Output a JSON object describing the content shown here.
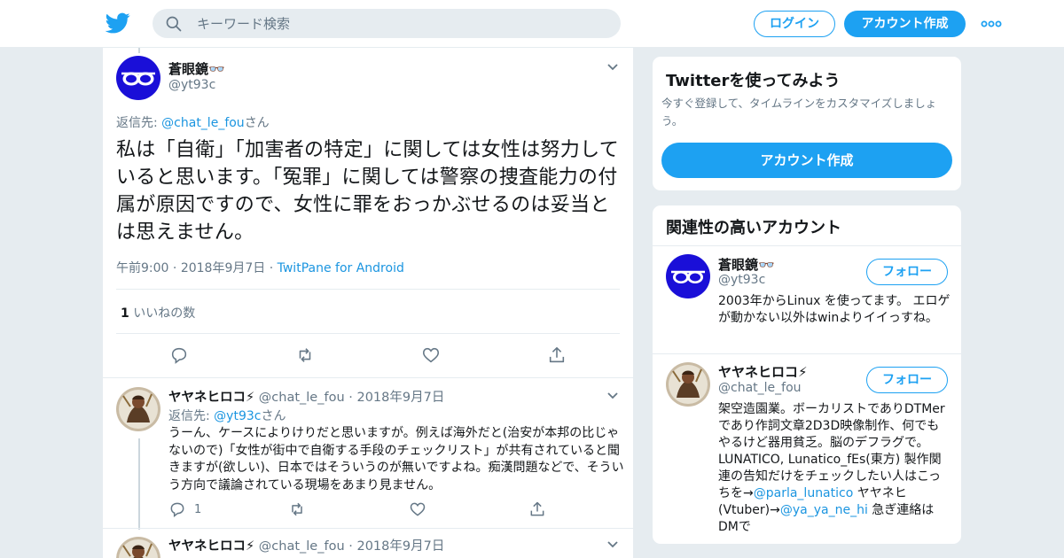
{
  "header": {
    "search_placeholder": "キーワード検索",
    "login_label": "ログイン",
    "signup_label": "アカウント作成"
  },
  "tweet": {
    "name": "蒼眼鏡👓",
    "handle": "@yt93c",
    "reply_prefix": "返信先: ",
    "reply_to": "@chat_le_fou",
    "reply_suffix": "さん",
    "text": "私は「自衛」「加害者の特定」に関しては女性は努力していると思います。「冤罪」に関しては警察の捜査能力の付属が原因ですので、女性に罪をおっかぶせるのは妥当とは思えません。",
    "time": "午前9:00",
    "date": "2018年9月7日",
    "source": "TwitPane for Android",
    "like_count": "1",
    "like_label": "いいねの数"
  },
  "replies": [
    {
      "name": "ヤヤネヒロコ⚡",
      "handle": "@chat_le_fou",
      "date": "2018年9月7日",
      "reply_prefix": "返信先: ",
      "reply_to": "@yt93c",
      "reply_suffix": "さん",
      "text": "うーん、ケースによりけりだと思いますが。例えば海外だと(治安が本邦の比じゃないので)「女性が街中で自衛する手段のチェックリスト」が共有されていると聞きますが(欲しい)、日本ではそういうのが無いですよね。痴漢問題などで、そういう方向で議論されている現場をあまり見ません。",
      "reply_count": "1"
    },
    {
      "name": "ヤヤネヒロコ⚡",
      "handle": "@chat_le_fou",
      "date": "2018年9月7日"
    }
  ],
  "sidebar": {
    "signup_card": {
      "title": "Twitterを使ってみよう",
      "subtitle": "今すぐ登録して、タイムラインをカスタマイズしましょう。",
      "button_label": "アカウント作成"
    },
    "related": {
      "title": "関連性の高いアカウント",
      "follow_label": "フォロー",
      "accounts": [
        {
          "name": "蒼眼鏡👓",
          "handle": "@yt93c",
          "bio": "2003年からLinux を使ってます。 エロゲが動かない以外はwinよりイイっすね。"
        },
        {
          "name": "ヤヤネヒロコ⚡",
          "handle": "@chat_le_fou",
          "bio_text1": "架空造園業。ボーカリストでありDTMerであり作詞文章2D3D映像制作、何でもやるけど器用貧乏。脳のデフラグで。LUNATICO, Lunatico_fEs(東方) 製作関連の告知だけをチェックしたい人はこっちを→",
          "bio_link1": "@parla_lunatico",
          "bio_text2": " ヤヤネヒ(Vtuber)→",
          "bio_link2": "@ya_ya_ne_hi",
          "bio_text3": " 急ぎ連絡はDMで"
        }
      ]
    }
  },
  "colors": {
    "accent": "#1da1f2",
    "link": "#1b95e0",
    "muted": "#657786",
    "border": "#e6ecf0",
    "background": "#e6ecf0"
  }
}
